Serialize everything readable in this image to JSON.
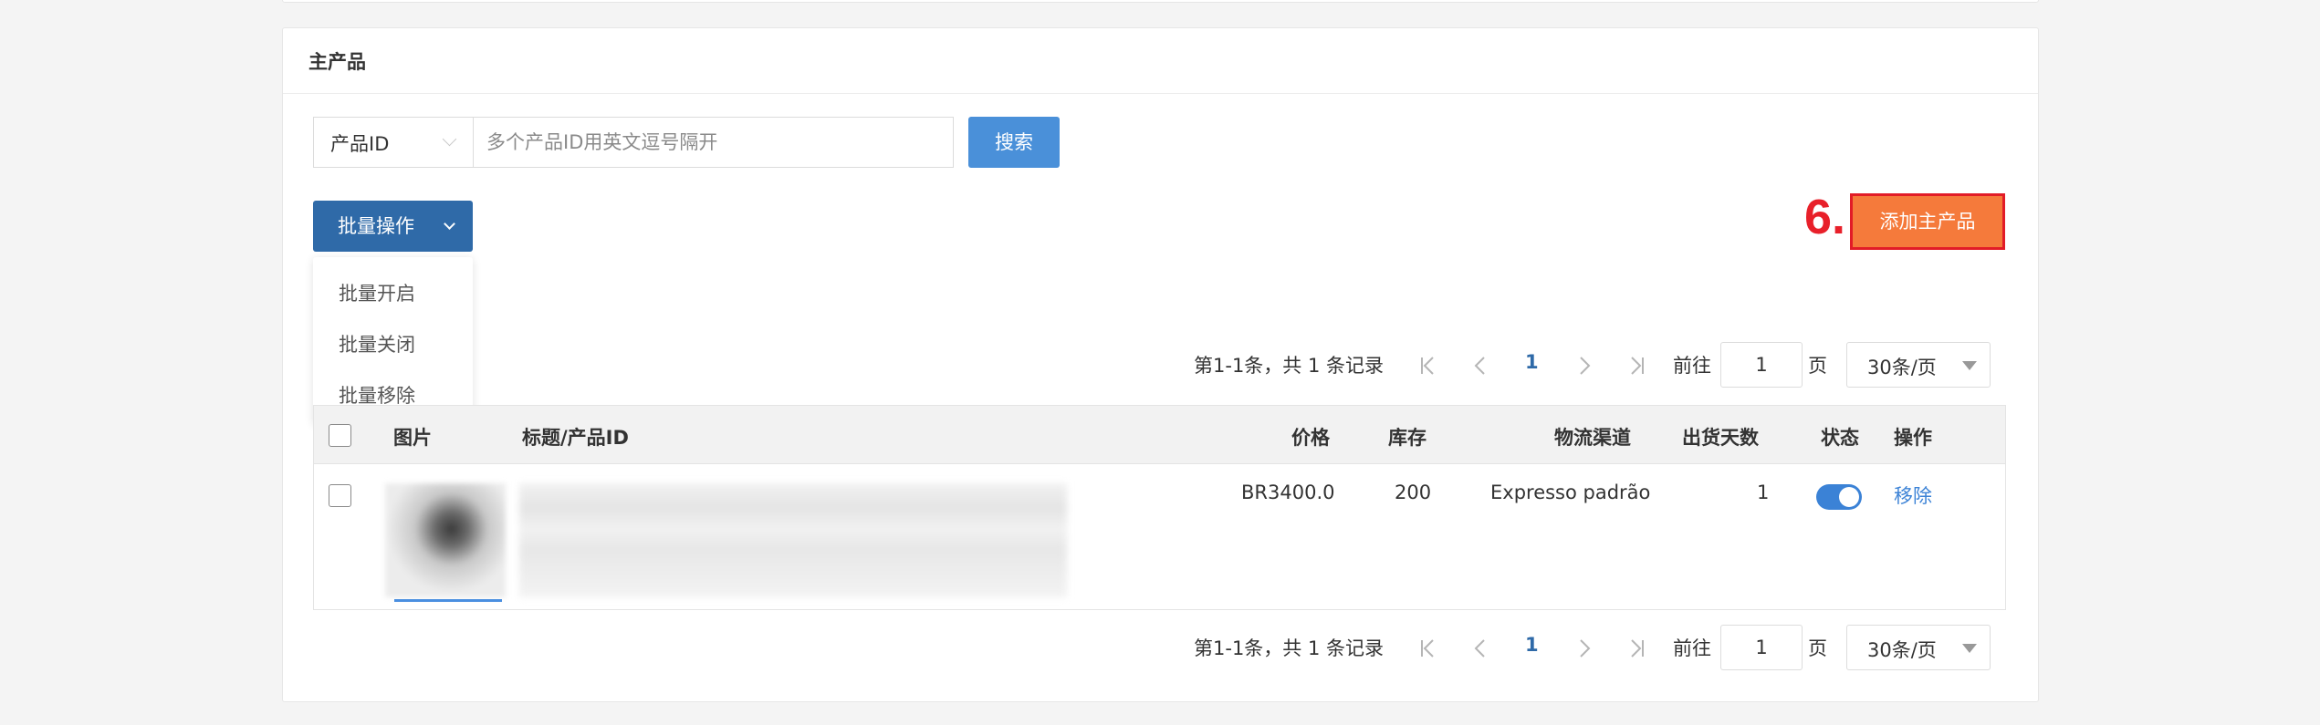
{
  "section": {
    "title": "主产品"
  },
  "search": {
    "field_selected": "产品ID",
    "placeholder": "多个产品ID用英文逗号隔开",
    "button_label": "搜索"
  },
  "batch": {
    "button_label": "批量操作",
    "menu_items": [
      "批量开启",
      "批量关闭",
      "批量移除"
    ]
  },
  "annotation": {
    "step_label": "6."
  },
  "add_button_label": "添加主产品",
  "pagination": {
    "summary": "第1-1条，共 1 条记录",
    "current_page": "1",
    "goto_label": "前往",
    "goto_value": "1",
    "page_label": "页",
    "page_size": "30条/页"
  },
  "table": {
    "headers": {
      "image": "图片",
      "title": "标题/产品ID",
      "price": "价格",
      "stock": "库存",
      "channel": "物流渠道",
      "days": "出货天数",
      "status": "状态",
      "action": "操作"
    },
    "rows": [
      {
        "price": "BR3400.0",
        "stock": "200",
        "channel": "Expresso padrão",
        "days": "1",
        "status_on": true,
        "action": "移除"
      }
    ]
  },
  "colors": {
    "primary": "#4a90d9",
    "batch_button": "#2f6aa8",
    "add_button": "#f57a3b",
    "annotation_red": "#e8202a",
    "toggle_on": "#3b82d6"
  }
}
